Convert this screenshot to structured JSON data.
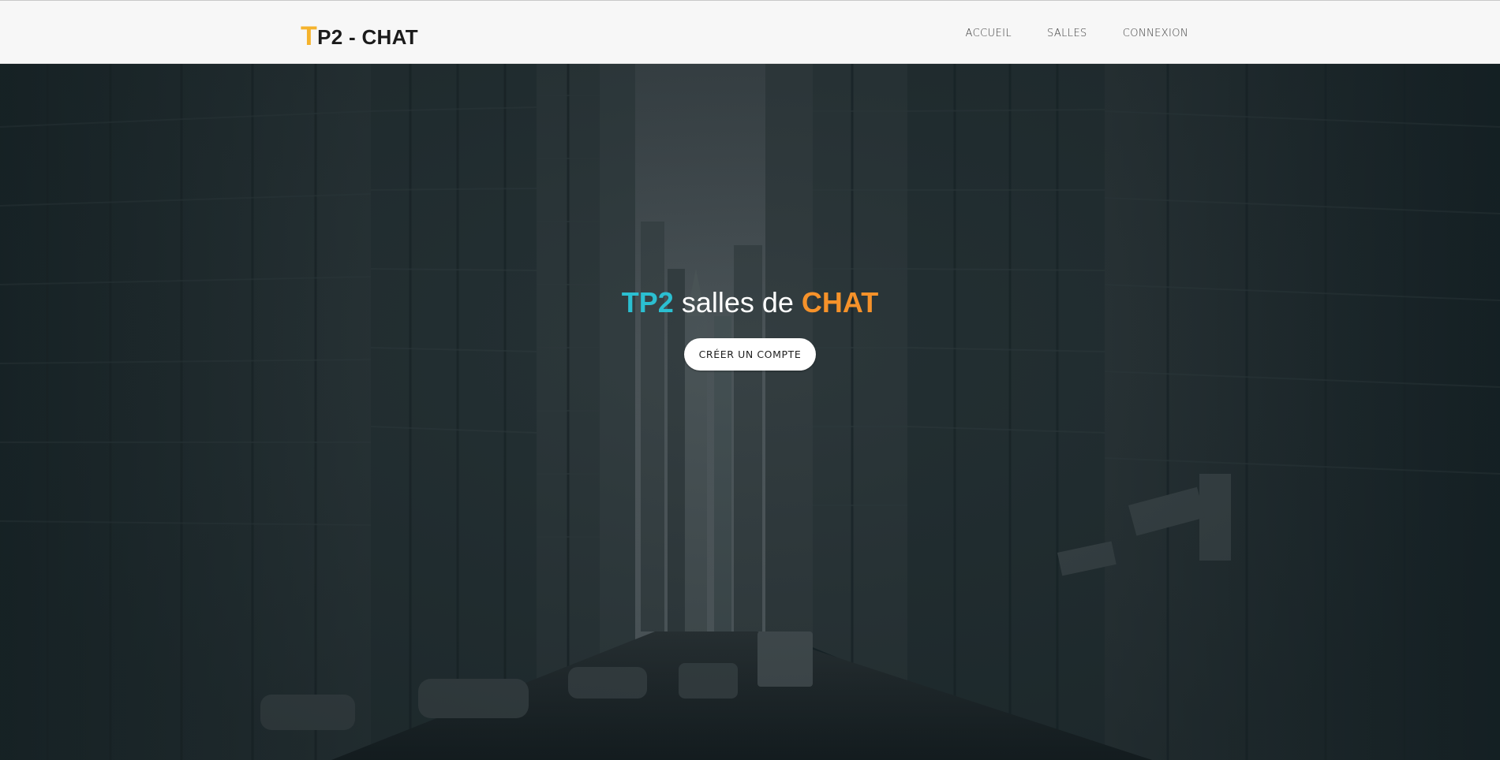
{
  "brand": {
    "first_letter": "T",
    "rest": "P2 - CHAT"
  },
  "nav": {
    "items": [
      {
        "label": "ACCUEIL"
      },
      {
        "label": "SALLES"
      },
      {
        "label": "CONNEXION"
      }
    ]
  },
  "hero": {
    "title_part1": "TP2",
    "title_part2": " salles de ",
    "title_part3": "CHAT",
    "cta_label": "CRÉER UN COMPTE",
    "background": "dark teal-tinted city street with skyscrapers"
  },
  "colors": {
    "brand_accent": "#f5b32c",
    "title_accent_1": "#2bbfd1",
    "title_accent_2": "#f6922a",
    "hero_overlay": "#1c2a2e",
    "navbar_bg": "#f7f7f7"
  }
}
